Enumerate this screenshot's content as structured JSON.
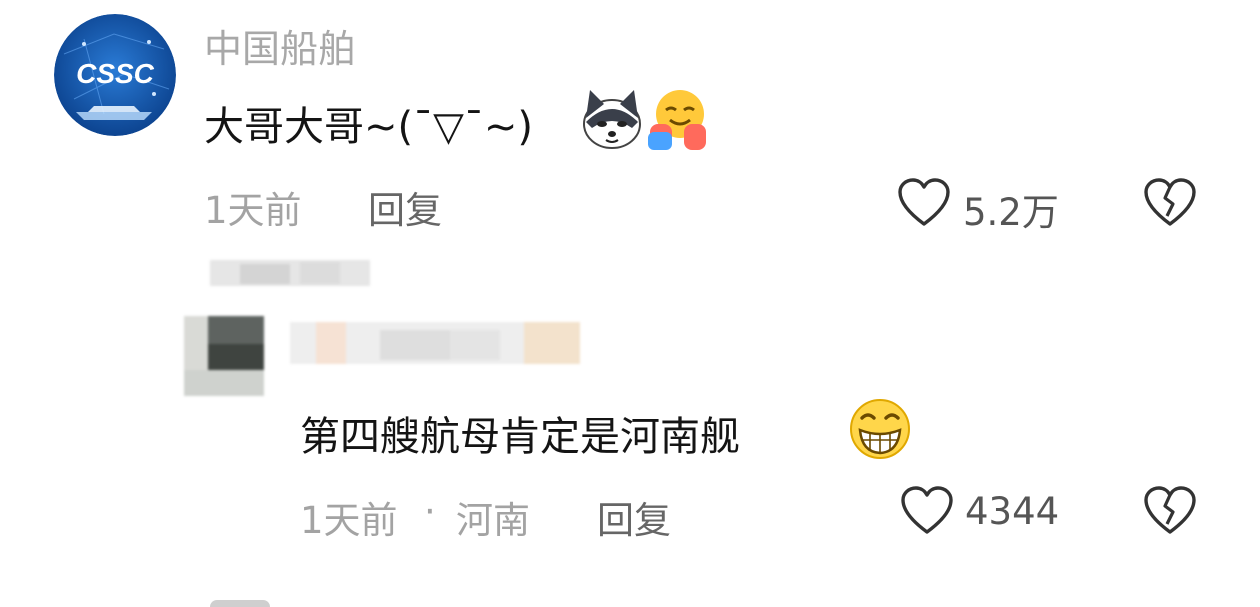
{
  "colors": {
    "meta_text": "#a3a3a3",
    "body_text": "#141414",
    "avatar_bg": "#0d4fa3",
    "icon_stroke": "#333333"
  },
  "comment": {
    "username": "中国船舶",
    "avatar_text": "CSSC",
    "text": "大哥大哥~(ˉ▽ˉ~)",
    "emoji_1": "dog-emoji",
    "emoji_2": "hug-emoji",
    "time": "1天前",
    "reply_label": "回复",
    "like_count": "5.2万"
  },
  "reply": {
    "username_redacted": true,
    "text": "第四艘航母肯定是河南舰",
    "emoji": "grin-emoji",
    "time": "1天前",
    "separator": "·",
    "location": "河南",
    "reply_label": "回复",
    "like_count": "4344"
  }
}
